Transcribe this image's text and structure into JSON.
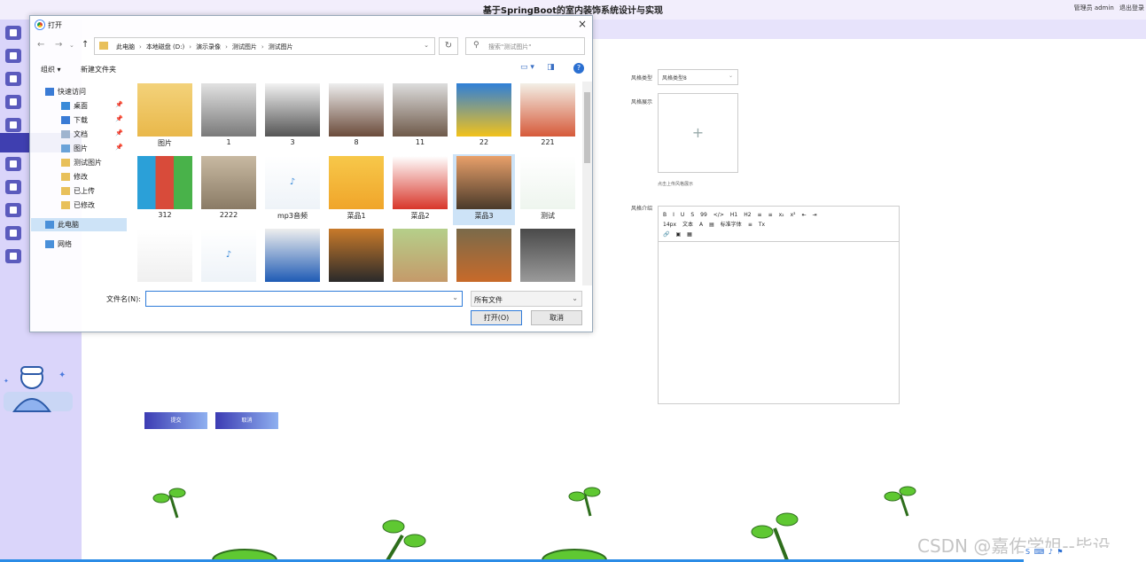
{
  "app": {
    "title": "基于SpringBoot的室内装饰系统设计与实现",
    "user_label": "管理员 admin",
    "logout": "退出登录"
  },
  "form": {
    "style_type_label": "风格类型",
    "style_type_value": "风格类型8",
    "style_display_label": "风格展示",
    "upload_hint": "点击上传风格展示",
    "style_intro_label": "风格介绍",
    "submit": "提交",
    "cancel": "取消"
  },
  "editor": {
    "toolbar_row1": [
      "B",
      "I",
      "U",
      "S",
      "99",
      "</>",
      "H1",
      "H2",
      "≡",
      "≡",
      "x₂",
      "x²",
      "⇤",
      "⇥"
    ],
    "toolbar_row2": [
      "14px",
      "文本",
      "A",
      "▤",
      "标准字体",
      "≡",
      "Tx"
    ],
    "toolbar_row3": [
      "🔗",
      "▣",
      "▦"
    ]
  },
  "dialog": {
    "title": "打开",
    "close": "×",
    "path": [
      "此电脑",
      "本地磁盘 (D:)",
      "演示录像",
      "测试图片",
      "测试图片"
    ],
    "search_placeholder": "搜索\"测试图片\"",
    "organize": "组织 ▾",
    "new_folder": "新建文件夹",
    "nav": [
      {
        "label": "快速访问"
      },
      {
        "label": "桌面"
      },
      {
        "label": "下载"
      },
      {
        "label": "文档"
      },
      {
        "label": "图片"
      },
      {
        "label": "测试图片"
      },
      {
        "label": "修改"
      },
      {
        "label": "已上传"
      },
      {
        "label": "已修改"
      },
      {
        "label": "此电脑"
      },
      {
        "label": "网络"
      }
    ],
    "files_row1": [
      "图片",
      "1",
      "3",
      "8",
      "11",
      "22",
      "221"
    ],
    "files_row2": [
      "312",
      "2222",
      "mp3音频",
      "菜品1",
      "菜品2",
      "菜品3",
      "测试"
    ],
    "file_name_label": "文件名(N):",
    "file_name_value": "",
    "file_type": "所有文件",
    "open": "打开(O)",
    "cancel": "取消"
  },
  "watermark": "CSDN @嘉佑学姐--毕设",
  "colors": {
    "sidebar": "#dad5fa",
    "accent": "#3f3fb0",
    "selection": "#cde3f7",
    "plant": "#5fc832"
  }
}
